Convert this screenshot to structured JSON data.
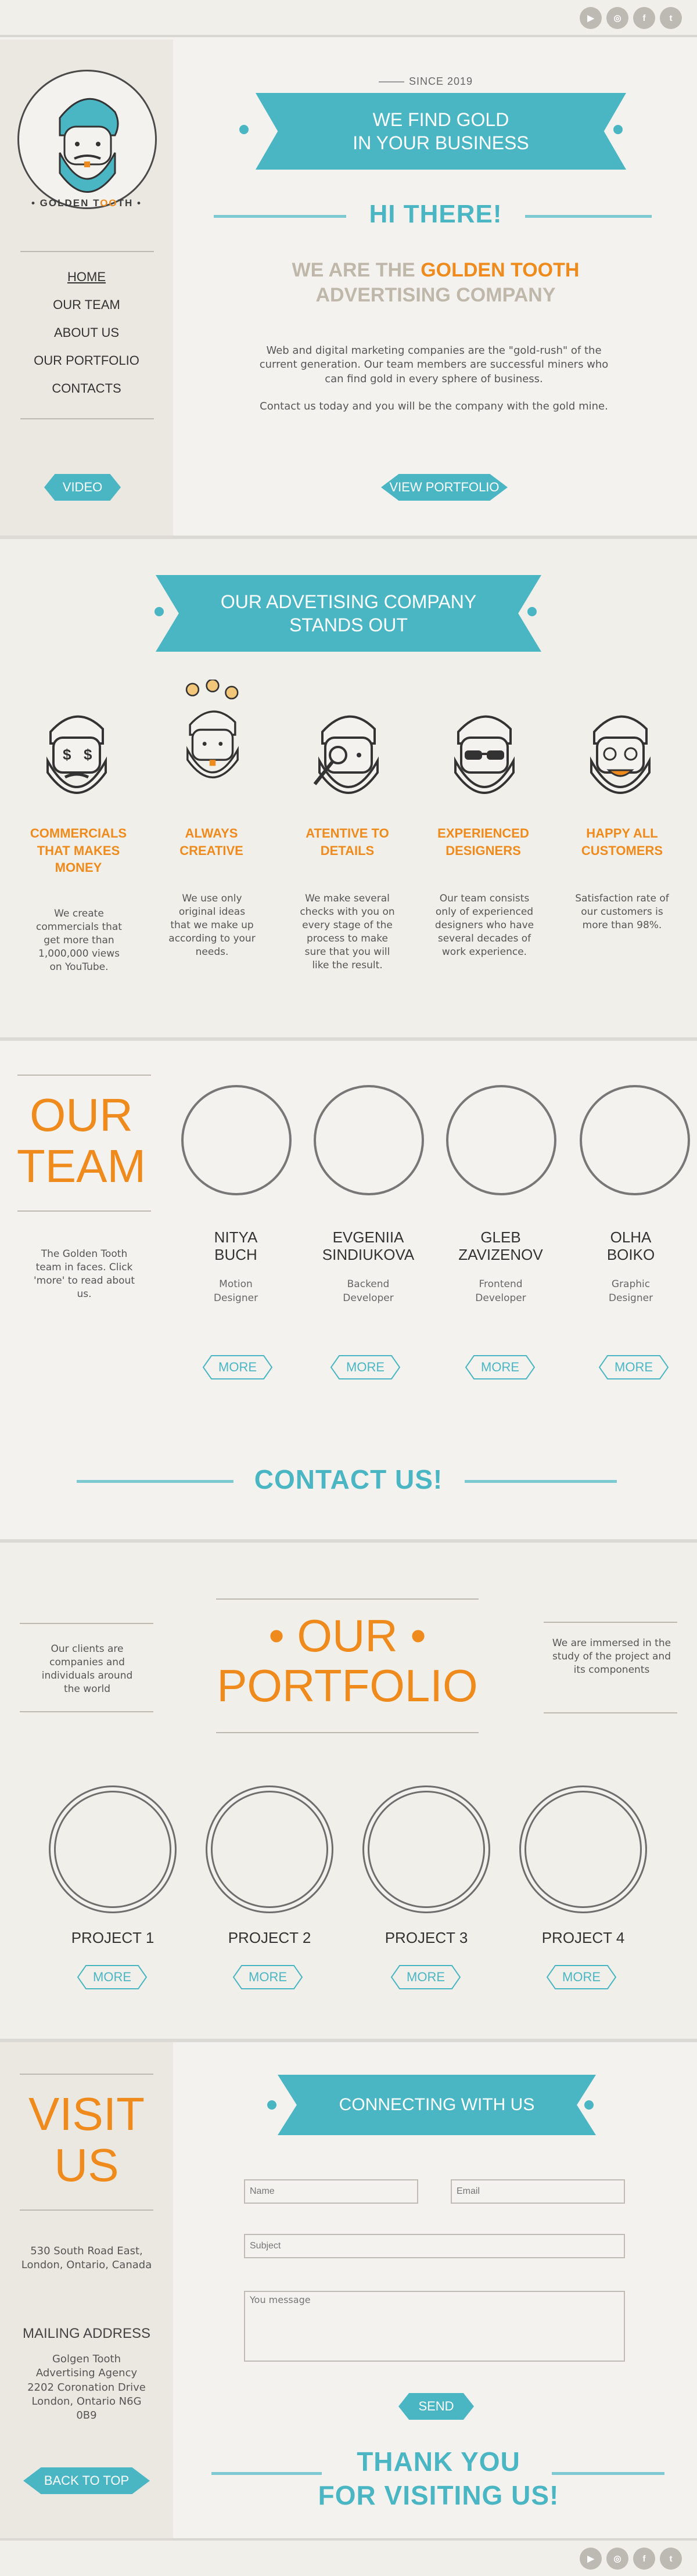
{
  "social": [
    "youtube-icon",
    "instagram-icon",
    "facebook-icon",
    "twitter-icon"
  ],
  "social_glyphs": [
    "▶",
    "◎",
    "f",
    "t"
  ],
  "hero": {
    "since": "SINCE 2019",
    "ribbon_line1": "WE FIND GOLD",
    "ribbon_line2": "IN YOUR BUSINESS",
    "hi_there": "HI THERE!",
    "we_are": "WE ARE THE",
    "brand": "GOLDEN TOOTH",
    "company": "ADVERTISING COMPANY",
    "para1": "Web and digital marketing companies are the \"gold-rush\" of the current generation. Our team members are successful miners who can find gold in every sphere of business.",
    "para2": "Contact us today and you will be the company with the gold mine.",
    "video_btn": "VIDEO",
    "portfolio_btn": "VIEW PORTFOLIO"
  },
  "logo": {
    "text_left": "GOLDEN T",
    "text_oo": "OO",
    "text_right": "TH"
  },
  "nav": [
    "HOME",
    "OUR TEAM",
    "ABOUT US",
    "OUR PORTFOLIO",
    "CONTACTS"
  ],
  "features": {
    "ribbon_line1": "OUR ADVETISING COMPANY",
    "ribbon_line2": "STANDS OUT",
    "items": [
      {
        "icon": "money-eyes-icon",
        "title": "COMMERCIALS THAT MAKES MONEY",
        "desc": "We create commercials that get more than 1,000,000 views on YouTube."
      },
      {
        "icon": "lightbulb-ideas-icon",
        "title": "ALWAYS CREATIVE",
        "desc": "We use only original ideas that we make up according to your needs."
      },
      {
        "icon": "magnifier-icon",
        "title": "ATENTIVE TO DETAILS",
        "desc": "We make several checks with you on every stage of the process to make sure that you will like the result."
      },
      {
        "icon": "sunglasses-icon",
        "title": "EXPERIENCED DESIGNERS",
        "desc": "Our team consists only of experienced designers who have several decades of work experience."
      },
      {
        "icon": "happy-face-icon",
        "title": "HAPPY ALL CUSTOMERS",
        "desc": "Satisfaction rate of our customers is more than 98%."
      }
    ]
  },
  "team": {
    "title_line1": "OUR",
    "title_line2": "TEAM",
    "desc": "The Golden Tooth team in faces. Click 'more' to read about us.",
    "more": "MORE",
    "members": [
      {
        "first": "NITYA",
        "last": "BUCH",
        "role1": "Motion",
        "role2": "Designer"
      },
      {
        "first": "EVGENIIA",
        "last": "SINDIUKOVA",
        "role1": "Backend",
        "role2": "Developer"
      },
      {
        "first": "GLEB",
        "last": "ZAVIZENOV",
        "role1": "Frontend",
        "role2": "Developer"
      },
      {
        "first": "OLHA",
        "last": "BOIKO",
        "role1": "Graphic",
        "role2": "Designer"
      }
    ],
    "contact_us": "CONTACT US!"
  },
  "portfolio": {
    "title_line1": "• OUR •",
    "title_line2": "PORTFOLIO",
    "left_text": "Our clients are companies and individuals around the world",
    "right_text": "We are immersed in the study of the project and its components",
    "more": "MORE",
    "projects": [
      "PROJECT 1",
      "PROJECT 2",
      "PROJECT 3",
      "PROJECT 4"
    ]
  },
  "contact": {
    "visit_line1": "VISIT",
    "visit_line2": "US",
    "address": "530 South Road East, London, Ontario, Canada",
    "mailing_label": "MAILING ADDRESS",
    "mailing": "Golgen Tooth Advertising Agency 2202 Coronation Drive London, Ontario N6G 0B9",
    "back_to_top": "BACK TO TOP",
    "ribbon": "CONNECTING WITH US",
    "name_placeholder": "Name",
    "email_placeholder": "Email",
    "subject_placeholder": "Subject",
    "message_placeholder": "You message",
    "send": "SEND",
    "thank_line1": "THANK YOU",
    "thank_line2": "FOR VISITING US!"
  },
  "colors": {
    "teal": "#4ab6c3",
    "orange": "#ef8a1c",
    "background": "#f4f2ee",
    "sidebar": "#ebe8e1"
  }
}
